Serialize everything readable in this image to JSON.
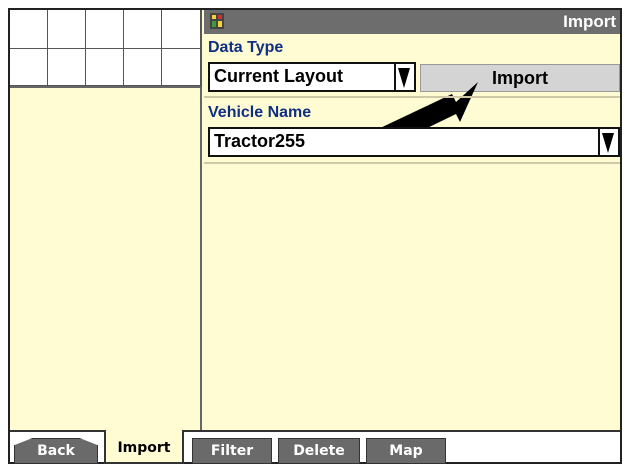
{
  "window": {
    "title": "Import",
    "icon": "app-icon"
  },
  "form": {
    "data_type_label": "Data Type",
    "data_type_value": "Current Layout",
    "import_button_label": "Import",
    "vehicle_name_label": "Vehicle Name",
    "vehicle_name_value": "Tractor255"
  },
  "tabs": [
    {
      "label": "Back",
      "active": false
    },
    {
      "label": "Import",
      "active": true
    },
    {
      "label": "Filter",
      "active": false
    },
    {
      "label": "Delete",
      "active": false
    },
    {
      "label": "Map",
      "active": false
    }
  ],
  "colors": {
    "background": "#fffbd2",
    "title_bar": "#6d6d6d",
    "label_text": "#0e2f84",
    "tab_inactive": "#6a6a6a"
  }
}
